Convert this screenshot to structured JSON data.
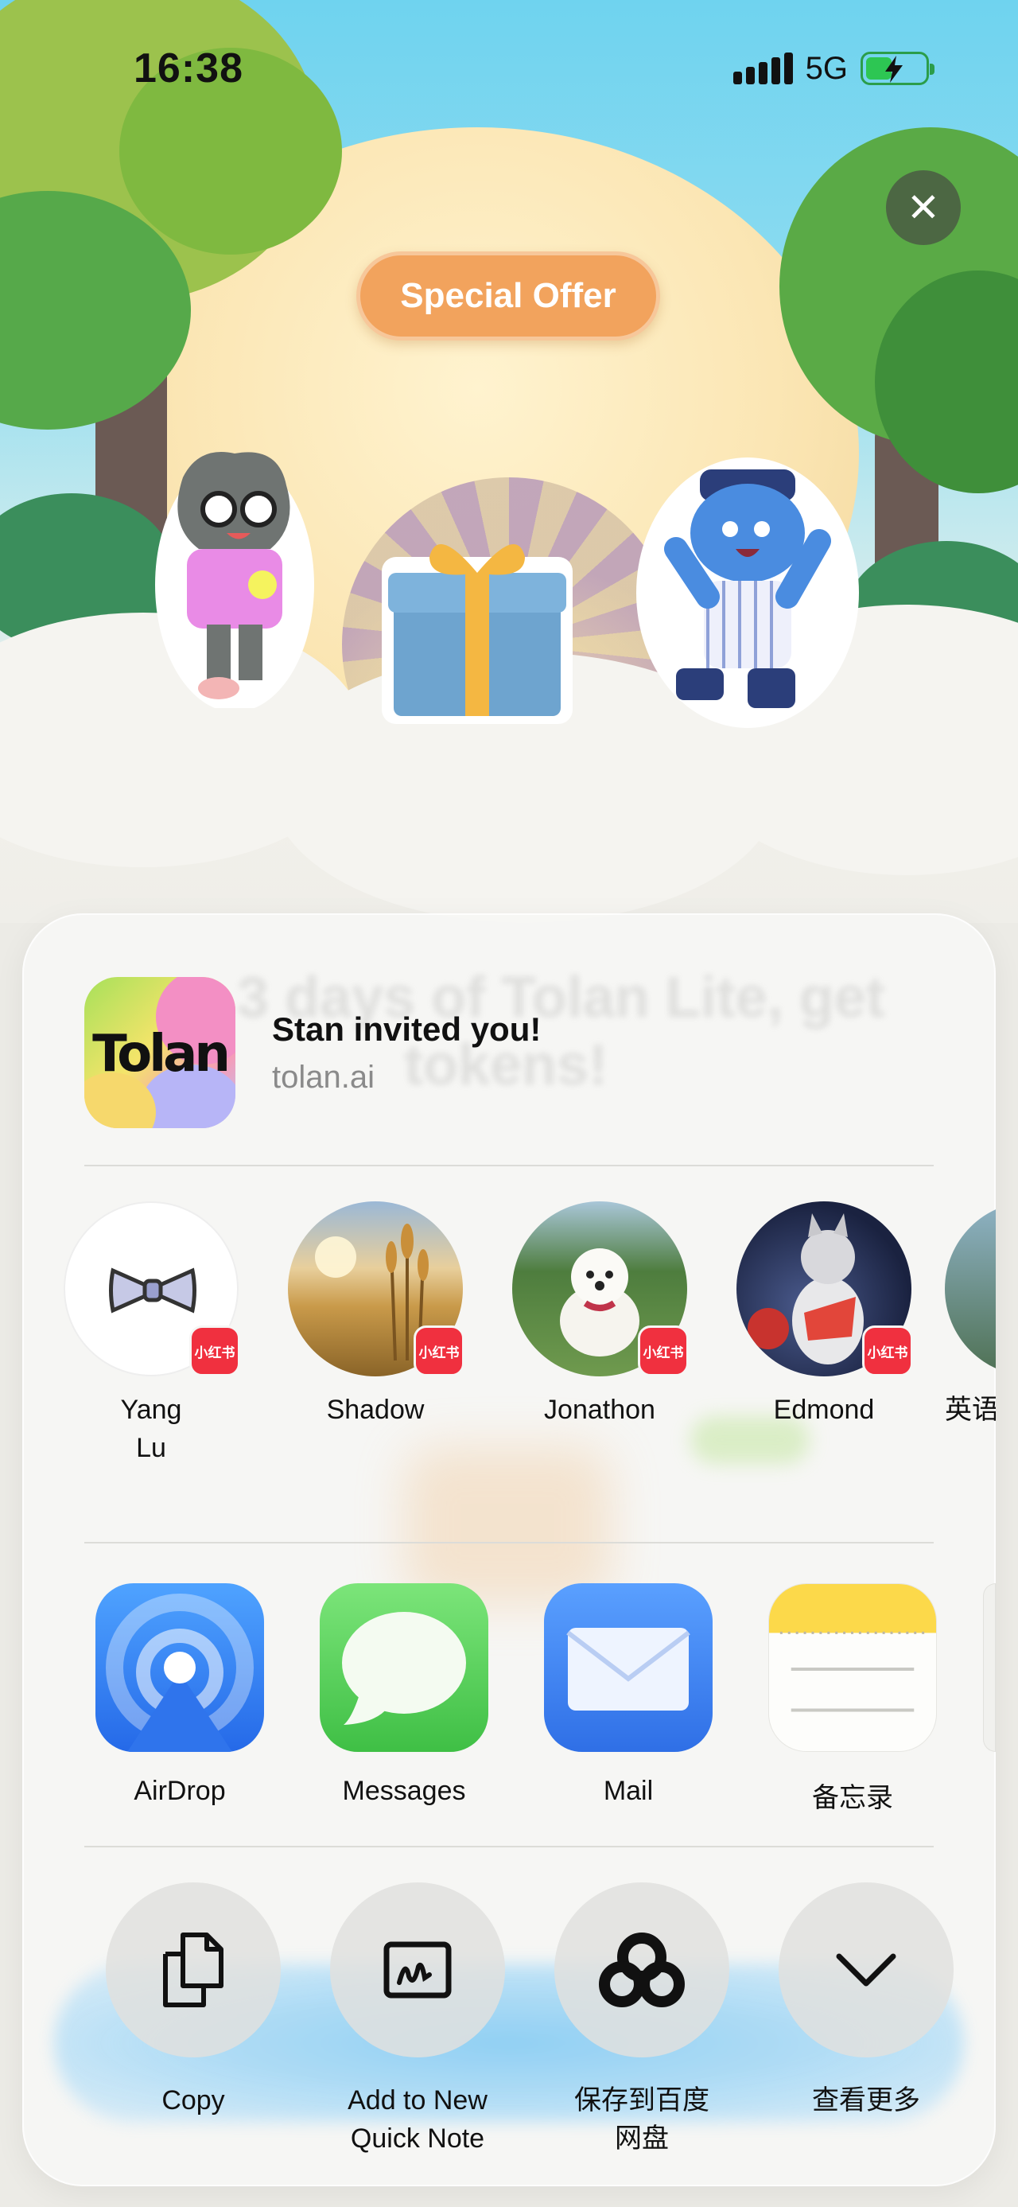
{
  "status_bar": {
    "time": "16:38",
    "network": "5G",
    "battery_level": 0.45
  },
  "banner": {
    "special_offer": "Special Offer"
  },
  "share_sheet": {
    "title": "Stan invited you!",
    "subtitle": "tolan.ai",
    "app_icon_text": "Tolan",
    "background_text": [
      "3 days of Tolan Lite, get",
      "tokens!"
    ],
    "people": [
      {
        "name": "Yang",
        "name2": "Lu",
        "badge": "小红书"
      },
      {
        "name": "Shadow",
        "name2": "",
        "badge": "小红书"
      },
      {
        "name": "Jonathon",
        "name2": "",
        "badge": "小红书"
      },
      {
        "name": "Edmond",
        "name2": "",
        "badge": "小红书"
      },
      {
        "name": "英语",
        "name2": "",
        "badge": ""
      }
    ],
    "apps": [
      {
        "label": "AirDrop",
        "icon": "airdrop-icon"
      },
      {
        "label": "Messages",
        "icon": "messages-icon"
      },
      {
        "label": "Mail",
        "icon": "mail-icon"
      },
      {
        "label": "备忘录",
        "icon": "notes-icon"
      }
    ],
    "actions": [
      {
        "label": "Copy",
        "label2": "",
        "icon": "copy-icon"
      },
      {
        "label": "Add to New",
        "label2": "Quick Note",
        "icon": "quick-note-icon"
      },
      {
        "label": "保存到百度",
        "label2": "网盘",
        "icon": "baidu-netdisk-icon"
      },
      {
        "label": "查看更多",
        "label2": "",
        "icon": "chevron-down-icon"
      }
    ]
  },
  "colors": {
    "offer_orange": "#f2a35d",
    "badge_red": "#f0303f",
    "airdrop_blue": "#2f7cf2",
    "messages_green": "#5ad35f",
    "mail_blue": "#3b82f6",
    "notes_yellow": "#fcd94a"
  }
}
